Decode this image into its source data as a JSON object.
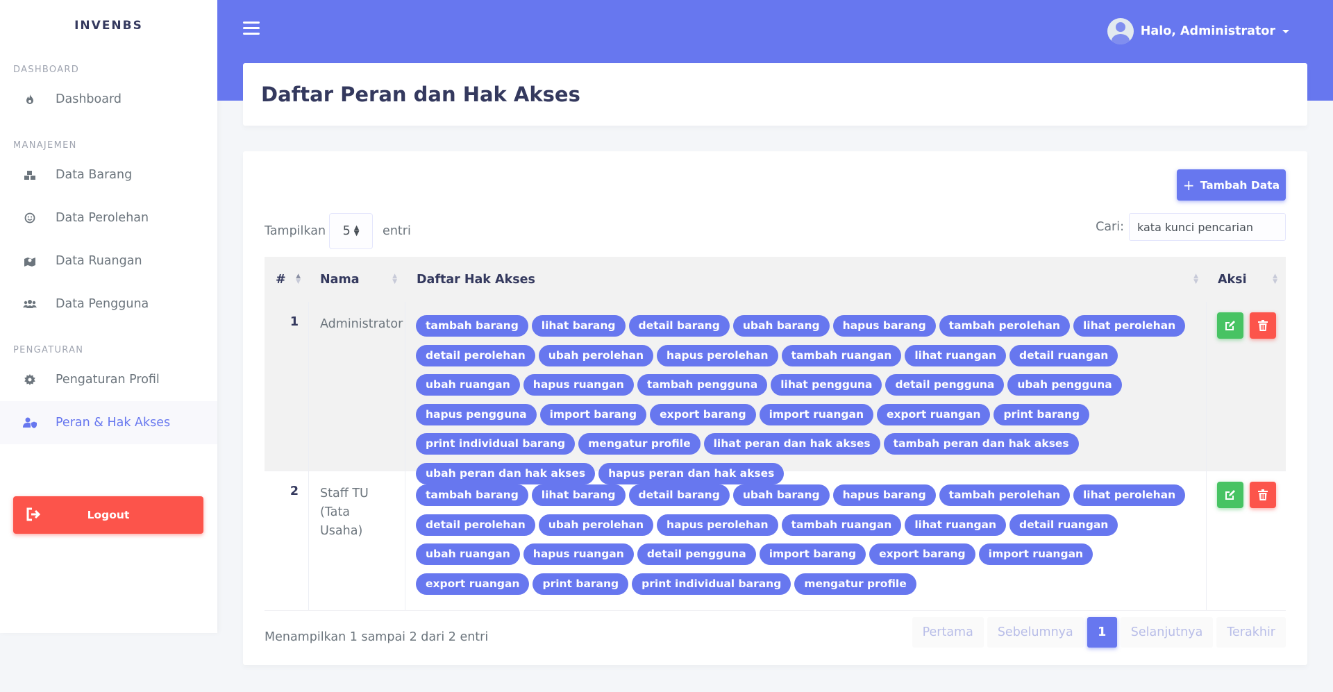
{
  "brand": "INVENBS",
  "sidebar": {
    "sections": [
      {
        "header": "DASHBOARD",
        "items": [
          {
            "label": "Dashboard",
            "icon": "fire-icon"
          }
        ]
      },
      {
        "header": "MANAJEMEN",
        "items": [
          {
            "label": "Data Barang",
            "icon": "boxes-icon"
          },
          {
            "label": "Data Perolehan",
            "icon": "smile-icon"
          },
          {
            "label": "Data Ruangan",
            "icon": "map-icon"
          },
          {
            "label": "Data Pengguna",
            "icon": "users-icon"
          }
        ]
      },
      {
        "header": "PENGATURAN",
        "items": [
          {
            "label": "Pengaturan Profil",
            "icon": "cog-icon"
          },
          {
            "label": "Peran & Hak Akses",
            "icon": "user-shield-icon",
            "active": true
          }
        ]
      }
    ],
    "logout": "Logout"
  },
  "topbar": {
    "greeting": "Halo, Administrator"
  },
  "page": {
    "title": "Daftar Peran dan Hak Akses"
  },
  "toolbar": {
    "add_label": "Tambah Data",
    "show_label": "Tampilkan",
    "show_value": "5",
    "entries_label": "entri",
    "search_label": "Cari:",
    "search_placeholder": "kata kunci pencarian"
  },
  "table": {
    "headers": {
      "num": "#",
      "name": "Nama",
      "perms": "Daftar Hak Akses",
      "actions": "Aksi"
    },
    "rows": [
      {
        "num": "1",
        "name": "Administrator",
        "perms": [
          "tambah barang",
          "lihat barang",
          "detail barang",
          "ubah barang",
          "hapus barang",
          "tambah perolehan",
          "lihat perolehan",
          "detail perolehan",
          "ubah perolehan",
          "hapus perolehan",
          "tambah ruangan",
          "lihat ruangan",
          "detail ruangan",
          "ubah ruangan",
          "hapus ruangan",
          "tambah pengguna",
          "lihat pengguna",
          "detail pengguna",
          "ubah pengguna",
          "hapus pengguna",
          "import barang",
          "export barang",
          "import ruangan",
          "export ruangan",
          "print barang",
          "print individual barang",
          "mengatur profile",
          "lihat peran dan hak akses",
          "tambah peran dan hak akses",
          "ubah peran dan hak akses",
          "hapus peran dan hak akses"
        ]
      },
      {
        "num": "2",
        "name": "Staff TU (Tata Usaha)",
        "perms": [
          "tambah barang",
          "lihat barang",
          "detail barang",
          "ubah barang",
          "hapus barang",
          "tambah perolehan",
          "lihat perolehan",
          "detail perolehan",
          "ubah perolehan",
          "hapus perolehan",
          "tambah ruangan",
          "lihat ruangan",
          "detail ruangan",
          "ubah ruangan",
          "hapus ruangan",
          "detail pengguna",
          "import barang",
          "export barang",
          "import ruangan",
          "export ruangan",
          "print barang",
          "print individual barang",
          "mengatur profile"
        ]
      }
    ]
  },
  "footer": {
    "info": "Menampilkan 1 sampai 2 dari 2 entri",
    "pagination": [
      "Pertama",
      "Sebelumnya",
      "1",
      "Selanjutnya",
      "Terakhir"
    ],
    "active_page": "1"
  },
  "colors": {
    "primary": "#6777ef",
    "success": "#47c363",
    "danger": "#fc544b"
  }
}
